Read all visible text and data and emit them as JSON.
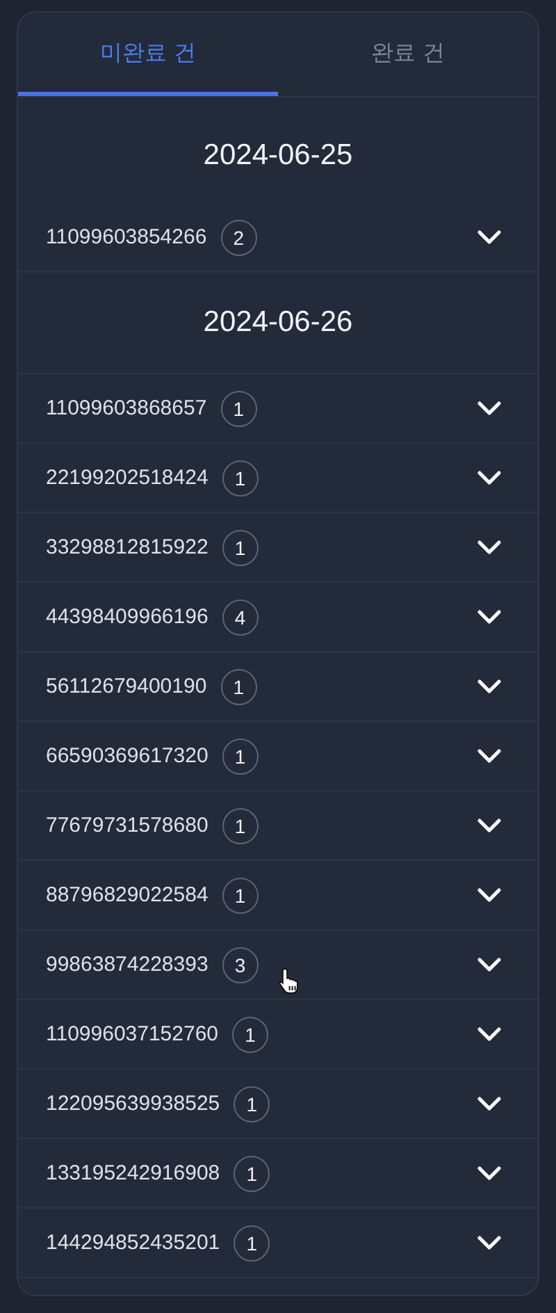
{
  "tabs": [
    {
      "label": "미완료 건",
      "selected": true
    },
    {
      "label": "완료 건",
      "selected": false
    }
  ],
  "groups": [
    {
      "date": "2024-06-25",
      "orders": [
        {
          "number": "11099603854266",
          "count": "2"
        }
      ]
    },
    {
      "date": "2024-06-26",
      "orders": [
        {
          "number": "11099603868657",
          "count": "1"
        },
        {
          "number": "22199202518424",
          "count": "1"
        },
        {
          "number": "33298812815922",
          "count": "1"
        },
        {
          "number": "44398409966196",
          "count": "4"
        },
        {
          "number": "56112679400190",
          "count": "1"
        },
        {
          "number": "66590369617320",
          "count": "1"
        },
        {
          "number": "77679731578680",
          "count": "1"
        },
        {
          "number": "88796829022584",
          "count": "1"
        },
        {
          "number": "99863874228393",
          "count": "3"
        },
        {
          "number": "110996037152760",
          "count": "1"
        },
        {
          "number": "122095639938525",
          "count": "1"
        },
        {
          "number": "133195242916908",
          "count": "1"
        },
        {
          "number": "144294852435201",
          "count": "1"
        }
      ]
    }
  ]
}
